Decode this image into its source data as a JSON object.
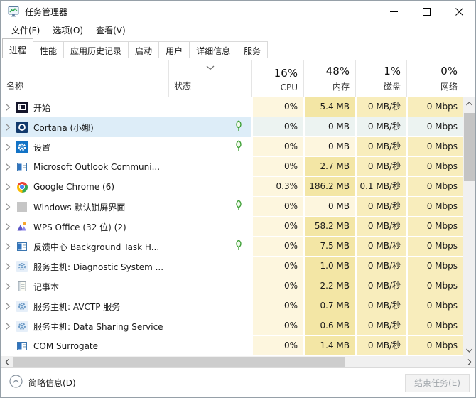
{
  "window": {
    "title": "任务管理器",
    "controls": [
      {
        "id": "minimize",
        "icon": "minimize-icon"
      },
      {
        "id": "maximize",
        "icon": "maximize-icon"
      },
      {
        "id": "close",
        "icon": "close-icon"
      }
    ]
  },
  "menu": {
    "items": [
      {
        "id": "file",
        "label": "文件(F)"
      },
      {
        "id": "options",
        "label": "选项(O)"
      },
      {
        "id": "view",
        "label": "查看(V)"
      }
    ]
  },
  "tabs": {
    "selected": "进程",
    "items": [
      {
        "id": "processes",
        "label": "进程",
        "selected": true
      },
      {
        "id": "performance",
        "label": "性能",
        "selected": false
      },
      {
        "id": "app-history",
        "label": "应用历史记录",
        "selected": false
      },
      {
        "id": "startup",
        "label": "启动",
        "selected": false
      },
      {
        "id": "users",
        "label": "用户",
        "selected": false
      },
      {
        "id": "details",
        "label": "详细信息",
        "selected": false
      },
      {
        "id": "services",
        "label": "服务",
        "selected": false
      }
    ]
  },
  "columns": {
    "name_label": "名称",
    "status_label": "状态",
    "sort_column": "状态",
    "value_cols": [
      {
        "id": "cpu",
        "percent": "16%",
        "label": "CPU"
      },
      {
        "id": "memory",
        "percent": "48%",
        "label": "内存"
      },
      {
        "id": "disk",
        "percent": "1%",
        "label": "磁盘"
      },
      {
        "id": "network",
        "percent": "0%",
        "label": "网络"
      }
    ]
  },
  "processes": [
    {
      "name": "开始",
      "icon": "start-icon",
      "leaf": false,
      "selected": false,
      "expandable": true,
      "values": [
        "0%",
        "5.4 MB",
        "0 MB/秒",
        "0 Mbps"
      ],
      "heat": [
        "low",
        "high",
        "mid",
        "mid"
      ]
    },
    {
      "name": "Cortana (小娜)",
      "icon": "cortana-icon",
      "leaf": true,
      "selected": true,
      "expandable": true,
      "values": [
        "0%",
        "0 MB",
        "0 MB/秒",
        "0 Mbps"
      ],
      "heat": [
        "low",
        "low",
        "mid",
        "mid"
      ]
    },
    {
      "name": "设置",
      "icon": "settings-gear-icon",
      "leaf": true,
      "selected": false,
      "expandable": true,
      "values": [
        "0%",
        "0 MB",
        "0 MB/秒",
        "0 Mbps"
      ],
      "heat": [
        "low",
        "low",
        "mid",
        "mid"
      ]
    },
    {
      "name": "Microsoft Outlook Communi...",
      "icon": "window-app-icon",
      "leaf": false,
      "selected": false,
      "expandable": true,
      "values": [
        "0%",
        "2.7 MB",
        "0 MB/秒",
        "0 Mbps"
      ],
      "heat": [
        "low",
        "high",
        "mid",
        "mid"
      ]
    },
    {
      "name": "Google Chrome (6)",
      "icon": "chrome-icon",
      "leaf": false,
      "selected": false,
      "expandable": true,
      "values": [
        "0.3%",
        "186.2 MB",
        "0.1 MB/秒",
        "0 Mbps"
      ],
      "heat": [
        "low",
        "high",
        "mid",
        "mid"
      ]
    },
    {
      "name": "Windows 默认锁屏界面",
      "icon": "lockscreen-gray-icon",
      "leaf": true,
      "selected": false,
      "expandable": true,
      "values": [
        "0%",
        "0 MB",
        "0 MB/秒",
        "0 Mbps"
      ],
      "heat": [
        "low",
        "low",
        "mid",
        "mid"
      ]
    },
    {
      "name": "WPS Office (32 位) (2)",
      "icon": "wps-office-icon",
      "leaf": false,
      "selected": false,
      "expandable": true,
      "values": [
        "0%",
        "58.2 MB",
        "0 MB/秒",
        "0 Mbps"
      ],
      "heat": [
        "low",
        "high",
        "mid",
        "mid"
      ]
    },
    {
      "name": "反馈中心 Background Task H...",
      "icon": "window-app-icon",
      "leaf": true,
      "selected": false,
      "expandable": true,
      "values": [
        "0%",
        "7.5 MB",
        "0 MB/秒",
        "0 Mbps"
      ],
      "heat": [
        "low",
        "high",
        "mid",
        "mid"
      ]
    },
    {
      "name": "服务主机: Diagnostic System ...",
      "icon": "service-gear-icon",
      "leaf": false,
      "selected": false,
      "expandable": true,
      "values": [
        "0%",
        "1.0 MB",
        "0 MB/秒",
        "0 Mbps"
      ],
      "heat": [
        "low",
        "high",
        "mid",
        "mid"
      ]
    },
    {
      "name": "记事本",
      "icon": "notepad-icon",
      "leaf": false,
      "selected": false,
      "expandable": true,
      "values": [
        "0%",
        "2.2 MB",
        "0 MB/秒",
        "0 Mbps"
      ],
      "heat": [
        "low",
        "high",
        "mid",
        "mid"
      ]
    },
    {
      "name": "服务主机: AVCTP 服务",
      "icon": "service-gear-icon",
      "leaf": false,
      "selected": false,
      "expandable": true,
      "values": [
        "0%",
        "0.7 MB",
        "0 MB/秒",
        "0 Mbps"
      ],
      "heat": [
        "low",
        "high",
        "mid",
        "mid"
      ]
    },
    {
      "name": "服务主机: Data Sharing Service",
      "icon": "service-gear-icon",
      "leaf": false,
      "selected": false,
      "expandable": true,
      "values": [
        "0%",
        "0.6 MB",
        "0 MB/秒",
        "0 Mbps"
      ],
      "heat": [
        "low",
        "high",
        "mid",
        "mid"
      ]
    },
    {
      "name": "COM Surrogate",
      "icon": "window-app-icon",
      "leaf": false,
      "selected": false,
      "expandable": false,
      "values": [
        "0%",
        "1.4 MB",
        "0 MB/秒",
        "0 Mbps"
      ],
      "heat": [
        "low",
        "high",
        "mid",
        "mid"
      ]
    }
  ],
  "footer": {
    "details_prefix": "简略信息(",
    "details_mnemonic": "D",
    "details_suffix": ")",
    "end_task_prefix": "结束任务(",
    "end_task_mnemonic": "E",
    "end_task_suffix": ")"
  },
  "colors": {
    "heat_low": "#fdf6de",
    "heat_mid": "#f8edbc",
    "heat_high": "#f3e6a5",
    "selected_row": "#ddedf8",
    "selected_cell": "#ecf3f1",
    "leaf_green": "#3fa037",
    "accent_blue": "#1273c6"
  }
}
